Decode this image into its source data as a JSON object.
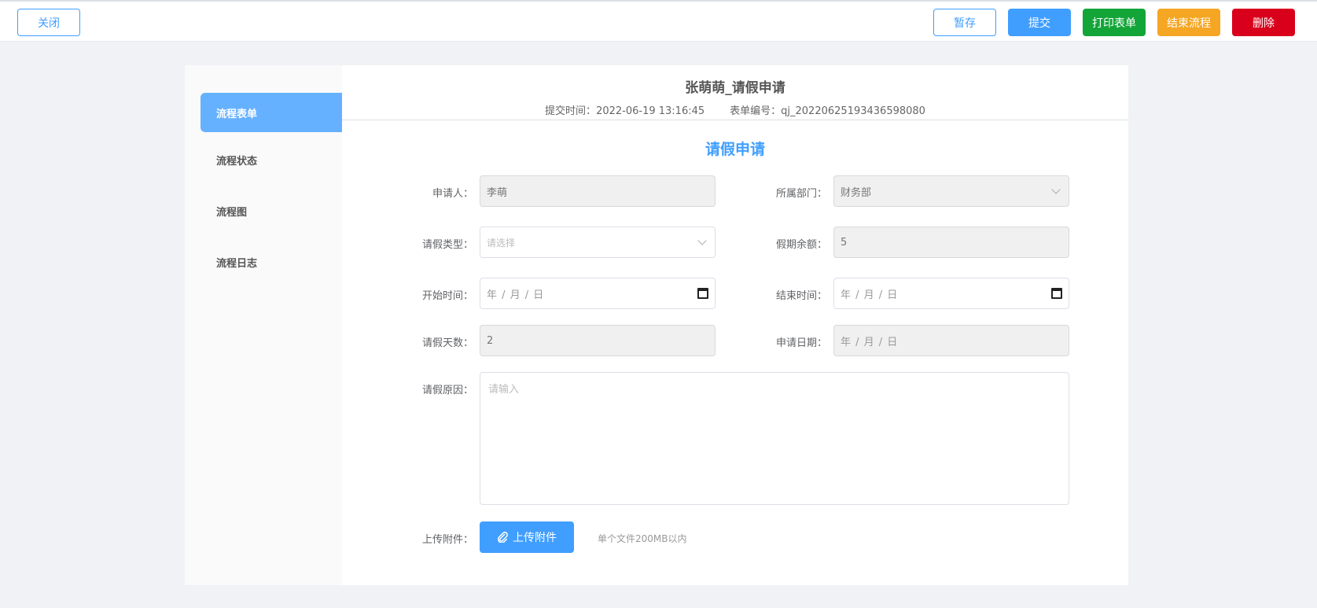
{
  "toolbar": {
    "close_label": "关闭",
    "draft_label": "暂存",
    "submit_label": "提交",
    "print_label": "打印表单",
    "end_label": "结束流程",
    "delete_label": "删除"
  },
  "sidebar": {
    "items": [
      {
        "label": "流程表单"
      },
      {
        "label": "流程状态"
      },
      {
        "label": "流程图"
      },
      {
        "label": "流程日志"
      }
    ]
  },
  "header": {
    "title": "张萌萌_请假申请",
    "submit_time_label": "提交时间：",
    "submit_time": "2022-06-19 13:16:45",
    "form_no_label": "表单编号：",
    "form_no": "qj_20220625193436598080"
  },
  "form": {
    "title": "请假申请",
    "applicant": {
      "label": "申请人：",
      "value": "李萌"
    },
    "department": {
      "label": "所属部门：",
      "value": "财务部"
    },
    "leave_type": {
      "label": "请假类型：",
      "placeholder": "请选择"
    },
    "balance": {
      "label": "假期余额：",
      "value": "5"
    },
    "start_time": {
      "label": "开始时间：",
      "placeholder": "年 / 月 / 日"
    },
    "end_time": {
      "label": "结束时间：",
      "placeholder": "年 / 月 / 日"
    },
    "days": {
      "label": "请假天数：",
      "value": "2"
    },
    "apply_date": {
      "label": "申请日期：",
      "placeholder": "年 / 月 / 日"
    },
    "reason": {
      "label": "请假原因：",
      "placeholder": "请输入"
    },
    "attachment": {
      "label": "上传附件：",
      "button_label": "上传附件",
      "hint": "单个文件200MB以内"
    }
  },
  "colors": {
    "primary": "#409eff",
    "success": "#13a538",
    "warning": "#f5a623",
    "danger": "#d9001b"
  }
}
